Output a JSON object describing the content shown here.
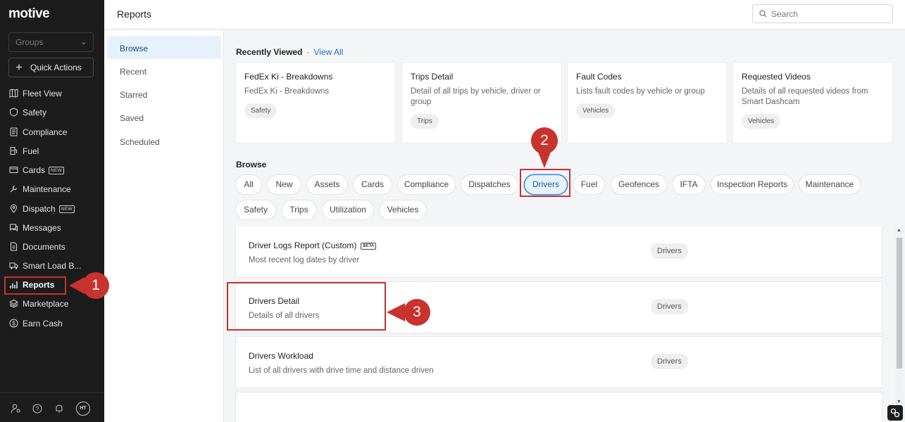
{
  "app": {
    "logo": "motive"
  },
  "leftnav": {
    "groups_placeholder": "Groups",
    "quick_actions": "Quick Actions",
    "items": [
      {
        "label": "Fleet View",
        "icon": "map-icon",
        "badge": ""
      },
      {
        "label": "Safety",
        "icon": "shield-icon",
        "badge": ""
      },
      {
        "label": "Compliance",
        "icon": "document-list-icon",
        "badge": ""
      },
      {
        "label": "Fuel",
        "icon": "fuel-pump-icon",
        "badge": ""
      },
      {
        "label": "Cards",
        "icon": "card-icon",
        "badge": "NEW"
      },
      {
        "label": "Maintenance",
        "icon": "wrench-icon",
        "badge": ""
      },
      {
        "label": "Dispatch",
        "icon": "location-pin-icon",
        "badge": "NEW"
      },
      {
        "label": "Messages",
        "icon": "chat-icon",
        "badge": ""
      },
      {
        "label": "Documents",
        "icon": "document-icon",
        "badge": ""
      },
      {
        "label": "Smart Load B...",
        "icon": "truck-icon",
        "badge": ""
      },
      {
        "label": "Reports",
        "icon": "chart-bars-icon",
        "badge": ""
      },
      {
        "label": "Marketplace",
        "icon": "layers-icon",
        "badge": ""
      },
      {
        "label": "Earn Cash",
        "icon": "dollar-circle-icon",
        "badge": ""
      }
    ],
    "avatar_initials": "HT"
  },
  "header": {
    "title": "Reports",
    "search_placeholder": "Search"
  },
  "subnav": {
    "items": [
      "Browse",
      "Recent",
      "Starred",
      "Saved",
      "Scheduled"
    ],
    "selected": "Browse"
  },
  "recently_viewed": {
    "heading": "Recently Viewed",
    "separator": "·",
    "view_all": "View All",
    "cards": [
      {
        "title": "FedEx Ki - Breakdowns",
        "desc": "FedEx Ki - Breakdowns",
        "tag": "Safety"
      },
      {
        "title": "Trips Detail",
        "desc": "Detail of all trips by vehicle, driver or group",
        "tag": "Trips"
      },
      {
        "title": "Fault Codes",
        "desc": "Lists fault codes by vehicle or group",
        "tag": "Vehicles"
      },
      {
        "title": "Requested Videos",
        "desc": "Details of all requested videos from Smart Dashcam",
        "tag": "Vehicles"
      }
    ]
  },
  "browse": {
    "heading": "Browse",
    "chips": [
      "All",
      "New",
      "Assets",
      "Cards",
      "Compliance",
      "Dispatches",
      "Drivers",
      "Fuel",
      "Geofences",
      "IFTA",
      "Inspection Reports",
      "Maintenance",
      "Safety",
      "Trips",
      "Utilization",
      "Vehicles"
    ],
    "selected": "Drivers"
  },
  "reports": [
    {
      "title": "Driver Logs Report (Custom)",
      "beta": "BETA",
      "desc": "Most recent log dates by driver",
      "tag": "Drivers"
    },
    {
      "title": "Drivers Detail",
      "beta": "",
      "desc": "Details of all drivers",
      "tag": "Drivers"
    },
    {
      "title": "Drivers Workload",
      "beta": "",
      "desc": "List of all drivers with drive time and distance driven",
      "tag": "Drivers"
    }
  ],
  "annotations": {
    "step1": "1",
    "step2": "2",
    "step3": "3",
    "color": "#c8322f"
  },
  "colors": {
    "accent": "#1a73c6",
    "nav_bg": "#1c1c1c",
    "selected_bg": "#e6f1fb"
  }
}
